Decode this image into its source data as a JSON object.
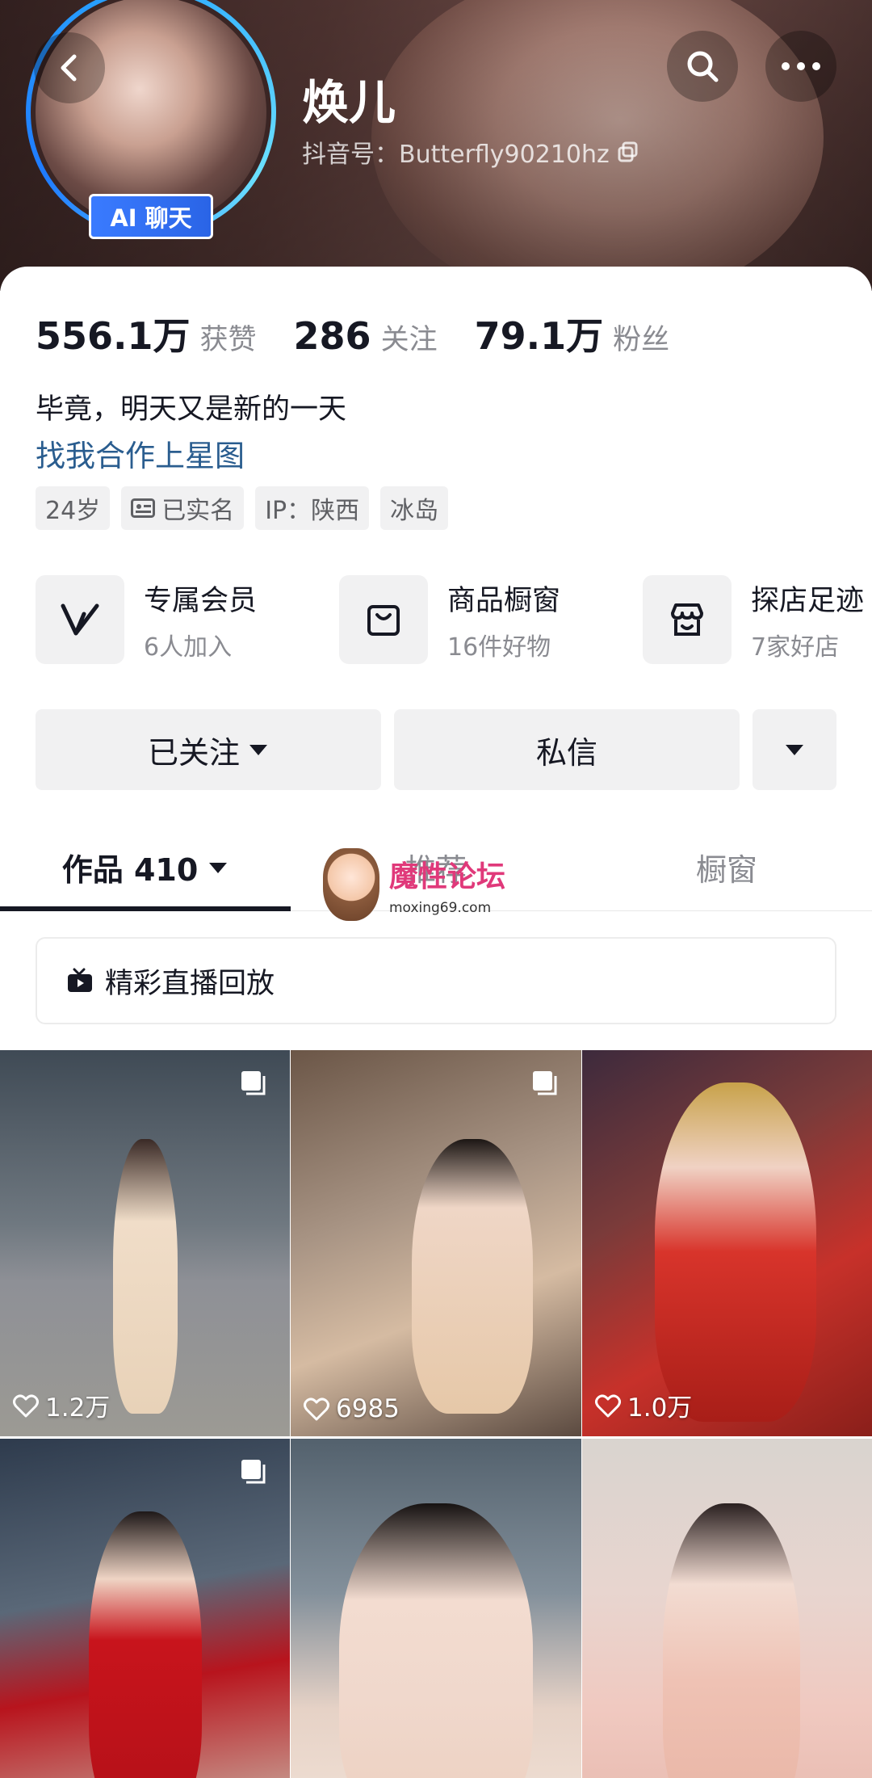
{
  "profile": {
    "nickname": "焕儿",
    "douyin_id": "抖音号：Butterfly90210hz",
    "ai_badge": "AI 聊天"
  },
  "stats": [
    {
      "num": "556.1万",
      "label": "获赞"
    },
    {
      "num": "286",
      "label": "关注"
    },
    {
      "num": "79.1万",
      "label": "粉丝"
    }
  ],
  "bio": "毕竟，明天又是新的一天",
  "link": "找我合作上星图",
  "tags": [
    "24岁",
    "已实名",
    "IP：陕西",
    "冰岛"
  ],
  "features": [
    {
      "title": "专属会员",
      "sub": "6人加入",
      "icon": "v-icon"
    },
    {
      "title": "商品橱窗",
      "sub": "16件好物",
      "icon": "bag-icon"
    },
    {
      "title": "探店足迹",
      "sub": "7家好店",
      "icon": "shop-icon"
    }
  ],
  "actions": {
    "follow": "已关注",
    "message": "私信"
  },
  "tabs": [
    "作品 410",
    "推荐",
    "橱窗"
  ],
  "watermark": {
    "title": "魔性论坛",
    "url": "moxing69.com"
  },
  "replay": "精彩直播回放",
  "videos": [
    {
      "likes": "1.2万",
      "multi": true
    },
    {
      "likes": "6985",
      "multi": true
    },
    {
      "likes": "1.0万",
      "multi": false
    },
    {
      "likes": "",
      "multi": true
    },
    {
      "likes": "",
      "multi": false
    },
    {
      "likes": "",
      "multi": false
    }
  ],
  "colors": {
    "link": "#2a5d8f",
    "ai_badge": "#3a7bff",
    "text": "#161823",
    "muted": "#8a8b91"
  }
}
